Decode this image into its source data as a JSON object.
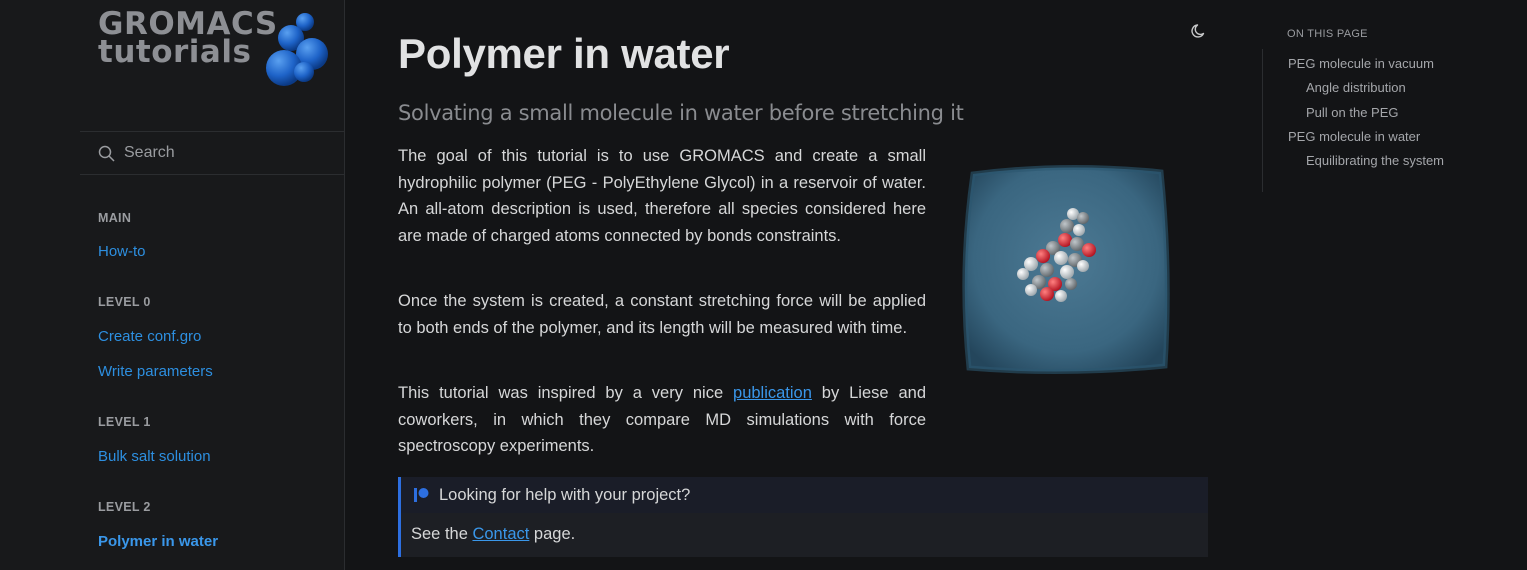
{
  "logo": {
    "line1": "GROMACS",
    "line2": "tutorials"
  },
  "search": {
    "placeholder": "Search"
  },
  "sidebar": {
    "sections": [
      {
        "caption": "MAIN",
        "links": [
          "How-to"
        ]
      },
      {
        "caption": "LEVEL 0",
        "links": [
          "Create conf.gro",
          "Write parameters"
        ]
      },
      {
        "caption": "LEVEL 1",
        "links": [
          "Bulk salt solution"
        ]
      },
      {
        "caption": "LEVEL 2",
        "links": [
          "Polymer in water"
        ]
      }
    ],
    "active": "Polymer in water"
  },
  "page": {
    "title": "Polymer in water",
    "subtitle": "Solvating a small molecule in water before stretching it",
    "p1": "The goal of this tutorial is to use GROMACS and create a small hydrophilic polymer (PEG - PolyEthylene Glycol) in a reservoir of water. An all-atom description is used, therefore all species considered here are made of charged atoms connected by bonds constraints.",
    "p2": "Once the system is created, a constant stretching force will be applied to both ends of the polymer, and its length will be measured with time.",
    "p3_before": "This tutorial was inspired by a very nice ",
    "p3_link": "publication",
    "p3_after": " by Liese and coworkers, in which they compare MD simulations with force spectroscopy experiments."
  },
  "callout": {
    "title": "Looking for help with your project?",
    "body_before": "See the ",
    "body_link": "Contact",
    "body_after": " page."
  },
  "toc": {
    "caption": "ON THIS PAGE",
    "items": [
      {
        "label": "PEG molecule in vacuum",
        "level": 1
      },
      {
        "label": "Angle distribution",
        "level": 2
      },
      {
        "label": "Pull on the PEG",
        "level": 2
      },
      {
        "label": "PEG molecule in water",
        "level": 1
      },
      {
        "label": "Equilibrating the system",
        "level": 2
      }
    ]
  },
  "colors": {
    "accent": "#3a97ea",
    "background": "#131416",
    "sidebar": "#18191b",
    "callout_border": "#2d6fe0"
  },
  "icons": {
    "search": "search-icon",
    "theme": "moon-icon",
    "callout": "patreon-icon"
  }
}
